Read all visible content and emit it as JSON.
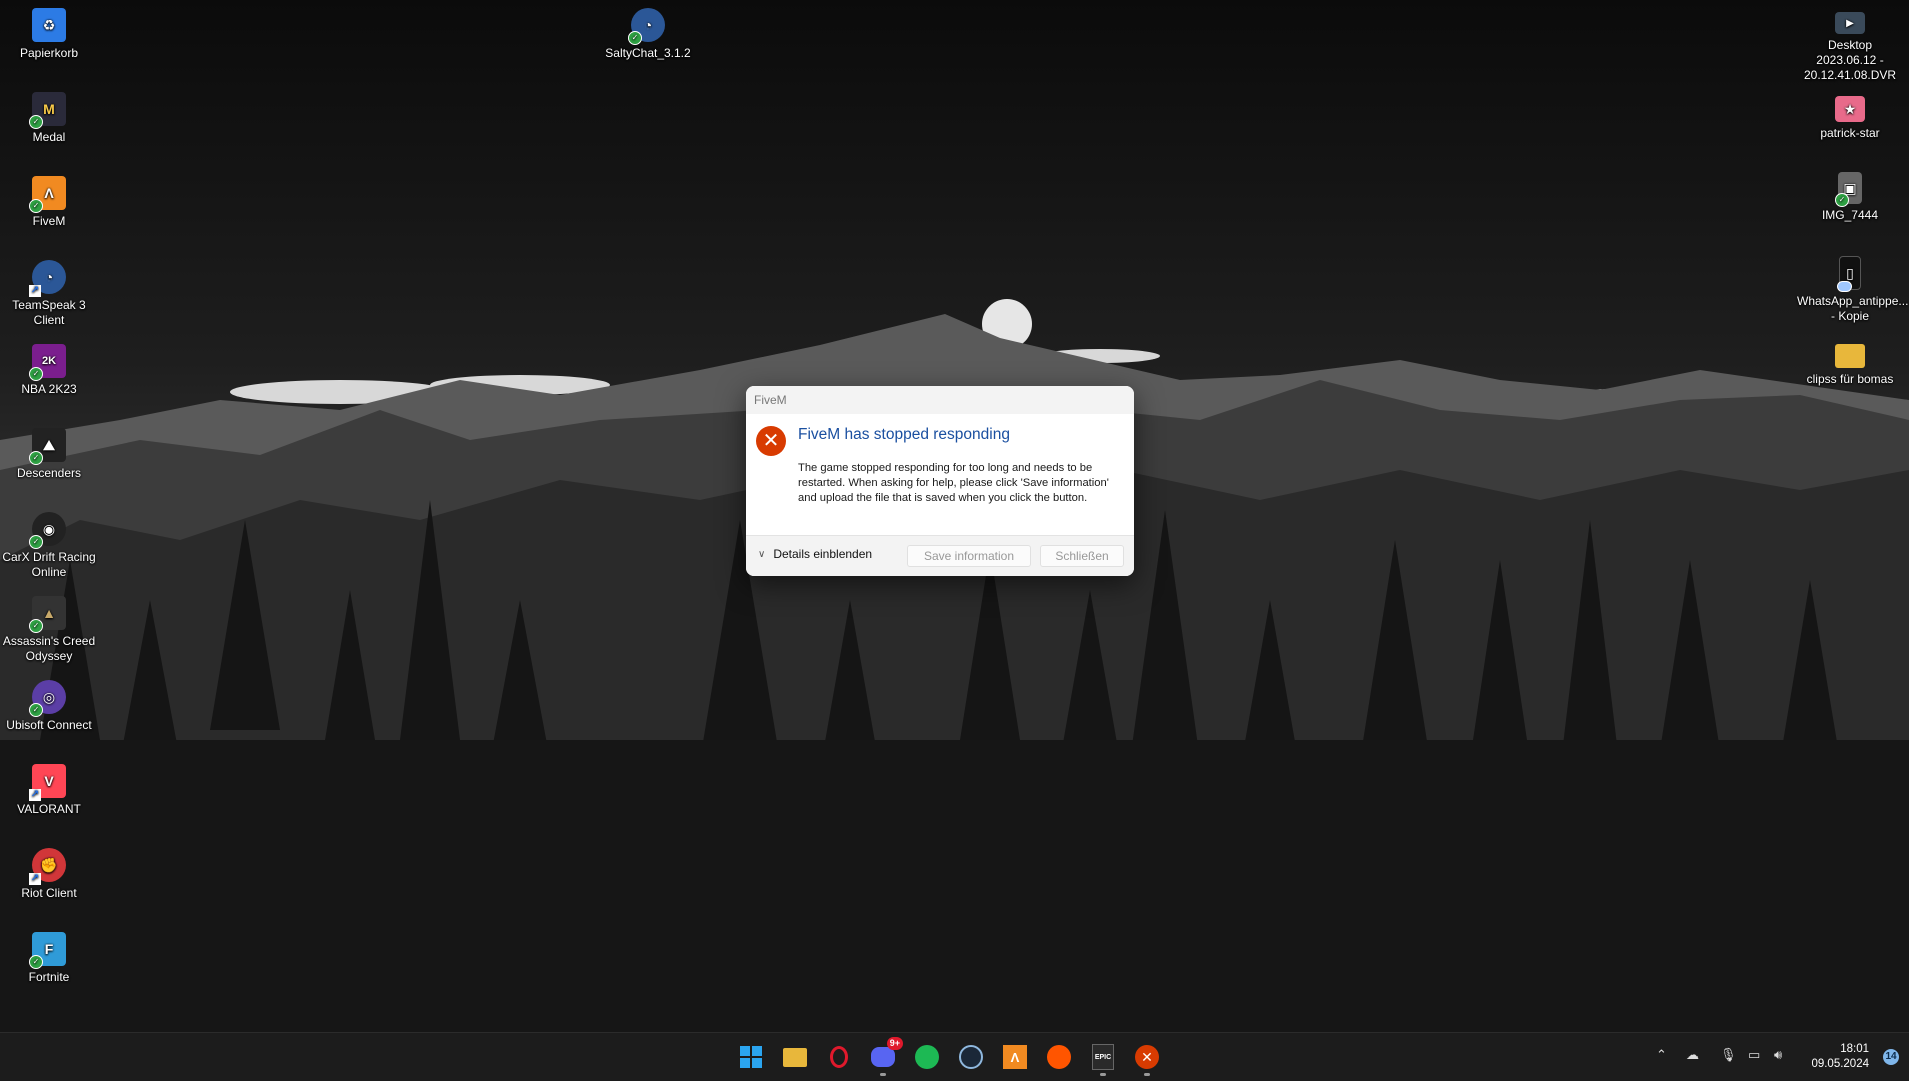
{
  "desktop_left": [
    {
      "label": "Papierkorb",
      "icon": "recycle-bin-icon",
      "color": "#2c7be5",
      "glyph": "♻",
      "badge": "none"
    },
    {
      "label": "Medal",
      "icon": "medal-icon",
      "color": "#2a2a3a",
      "glyph": "M",
      "badge": "check"
    },
    {
      "label": "FiveM",
      "icon": "fivem-icon",
      "color": "#f18a21",
      "glyph": "Λ",
      "badge": "check"
    },
    {
      "label": "TeamSpeak 3 Client",
      "icon": "teamspeak-icon",
      "color": "#2b5797",
      "glyph": "◔",
      "badge": "link"
    },
    {
      "label": "NBA 2K23",
      "icon": "nba2k23-icon",
      "color": "#7b1e8e",
      "glyph": "2K",
      "badge": "check"
    },
    {
      "label": "Descenders",
      "icon": "descenders-icon",
      "color": "#222",
      "glyph": "⛰",
      "badge": "check"
    },
    {
      "label": "CarX Drift Racing Online",
      "icon": "carx-icon",
      "color": "#222",
      "glyph": "◉",
      "badge": "check"
    },
    {
      "label": "Assassin's Creed Odyssey",
      "icon": "assassins-creed-icon",
      "color": "#333",
      "glyph": "▲",
      "badge": "check"
    },
    {
      "label": "Ubisoft Connect",
      "icon": "ubisoft-connect-icon",
      "color": "#5b3ea6",
      "glyph": "◎",
      "badge": "check"
    },
    {
      "label": "VALORANT",
      "icon": "valorant-icon",
      "color": "#ff4655",
      "glyph": "V",
      "badge": "link"
    },
    {
      "label": "Riot Client",
      "icon": "riot-client-icon",
      "color": "#d13639",
      "glyph": "✊",
      "badge": "link"
    },
    {
      "label": "Fortnite",
      "icon": "fortnite-icon",
      "color": "#2f9bd8",
      "glyph": "F",
      "badge": "check"
    }
  ],
  "desktop_top": [
    {
      "label": "SaltyChat_3.1.2",
      "icon": "saltychat-icon",
      "color": "#2b5797",
      "glyph": "◔",
      "badge": "check"
    }
  ],
  "desktop_right": [
    {
      "label": "Desktop 2023.06.12 - 20.12.41.08.DVR",
      "icon": "video-file-icon",
      "color": "#3a4a5a",
      "glyph": "▶",
      "badge": "none"
    },
    {
      "label": "patrick-star",
      "icon": "image-file-icon",
      "color": "#e86a8a",
      "glyph": "★",
      "badge": "none"
    },
    {
      "label": "IMG_7444",
      "icon": "image-file-icon",
      "color": "#666",
      "glyph": "▣",
      "badge": "check"
    },
    {
      "label": "WhatsApp_antippe... - Kopie",
      "icon": "phone-image-icon",
      "color": "#111",
      "glyph": "▯",
      "badge": "cloud"
    },
    {
      "label": "clipss für bomas",
      "icon": "folder-icon",
      "color": "#e8b73b",
      "glyph": "",
      "badge": "none"
    }
  ],
  "dialog": {
    "title": "FiveM",
    "heading": "FiveM has stopped responding",
    "message": "The game stopped responding for too long and needs to be restarted. When asking for help, please click 'Save information' and upload the file that is saved when you click the button.",
    "details_label": "Details einblenden",
    "save_label": "Save information",
    "close_label": "Schließen",
    "heading_color": "#1a4fa0",
    "error_color": "#d83b01"
  },
  "taskbar": {
    "apps": [
      {
        "name": "start",
        "icon": "windows-start-icon",
        "color": "#2ba5f0",
        "glyph": "⊞",
        "running": false
      },
      {
        "name": "file-explorer",
        "icon": "folder-icon",
        "color": "#e8b73b",
        "glyph": "▬",
        "running": false
      },
      {
        "name": "opera",
        "icon": "opera-icon",
        "color": "#e0192c",
        "glyph": "O",
        "running": false
      },
      {
        "name": "discord",
        "icon": "discord-icon",
        "color": "#5865f2",
        "glyph": "◕",
        "running": true,
        "badge": "9+"
      },
      {
        "name": "spotify",
        "icon": "spotify-icon",
        "color": "#1db954",
        "glyph": "≋",
        "running": false
      },
      {
        "name": "steam",
        "icon": "steam-icon",
        "color": "#1b2838",
        "glyph": "⚙",
        "running": false
      },
      {
        "name": "fivem",
        "icon": "fivem-icon",
        "color": "#f18a21",
        "glyph": "Λ",
        "running": false
      },
      {
        "name": "soundcloud",
        "icon": "soundcloud-icon",
        "color": "#ff5500",
        "glyph": "☁",
        "running": false
      },
      {
        "name": "epic-games",
        "icon": "epic-games-icon",
        "color": "#2a2a2a",
        "glyph": "EPIC",
        "running": true
      },
      {
        "name": "fivem-error",
        "icon": "error-icon",
        "color": "#d83b01",
        "glyph": "✕",
        "running": true
      }
    ],
    "time": "18:01",
    "date": "09.05.2024",
    "notification_count": "14"
  }
}
